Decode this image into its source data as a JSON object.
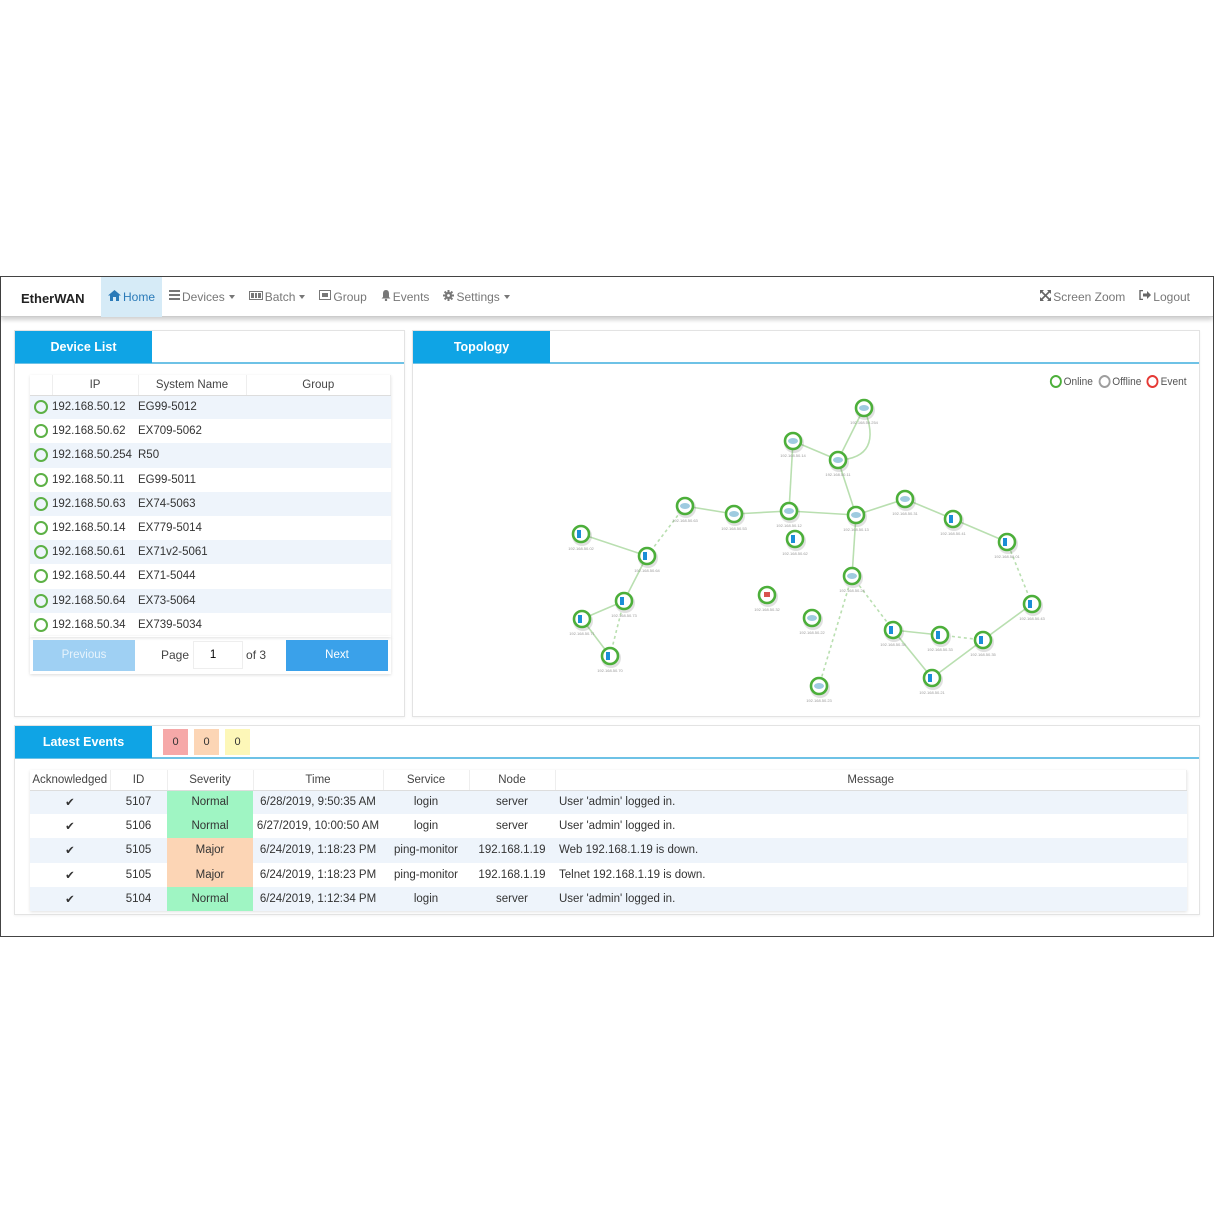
{
  "navbar": {
    "brand": "EtherWAN",
    "items": [
      {
        "label": "Home",
        "icon": "home-icon",
        "active": true
      },
      {
        "label": "Devices",
        "icon": "list-icon",
        "dropdown": true
      },
      {
        "label": "Batch",
        "icon": "batch-icon",
        "dropdown": true
      },
      {
        "label": "Group",
        "icon": "group-icon"
      },
      {
        "label": "Events",
        "icon": "bell-icon"
      },
      {
        "label": "Settings",
        "icon": "gear-icon",
        "dropdown": true
      }
    ],
    "right_items": [
      {
        "label": "Screen Zoom",
        "icon": "expand-icon"
      },
      {
        "label": "Logout",
        "icon": "logout-icon"
      }
    ]
  },
  "device_list": {
    "title": "Device List",
    "columns": [
      "",
      "IP",
      "System Name",
      "Group"
    ],
    "rows": [
      {
        "status": "online",
        "ip": "192.168.50.12",
        "name": "EG99-5012",
        "group": ""
      },
      {
        "status": "online",
        "ip": "192.168.50.62",
        "name": "EX709-5062",
        "group": ""
      },
      {
        "status": "online",
        "ip": "192.168.50.254",
        "name": "R50",
        "group": ""
      },
      {
        "status": "online",
        "ip": "192.168.50.11",
        "name": "EG99-5011",
        "group": ""
      },
      {
        "status": "online",
        "ip": "192.168.50.63",
        "name": "EX74-5063",
        "group": ""
      },
      {
        "status": "online",
        "ip": "192.168.50.14",
        "name": "EX779-5014",
        "group": ""
      },
      {
        "status": "online",
        "ip": "192.168.50.61",
        "name": "EX71v2-5061",
        "group": ""
      },
      {
        "status": "online",
        "ip": "192.168.50.44",
        "name": "EX71-5044",
        "group": ""
      },
      {
        "status": "online",
        "ip": "192.168.50.64",
        "name": "EX73-5064",
        "group": ""
      },
      {
        "status": "online",
        "ip": "192.168.50.34",
        "name": "EX739-5034",
        "group": ""
      }
    ],
    "pager": {
      "previous": "Previous",
      "page_label": "Page",
      "page_value": "1",
      "of_label": "of 3",
      "next": "Next"
    }
  },
  "topology": {
    "title": "Topology",
    "legend": [
      {
        "label": "Online",
        "color": "#4caf3a"
      },
      {
        "label": "Offline",
        "color": "#9e9e9e"
      },
      {
        "label": "Event",
        "color": "#e53935"
      }
    ],
    "nodes": [
      {
        "id": "n254",
        "type": "switch",
        "label": "192.168.50.254"
      },
      {
        "id": "n14",
        "type": "switch",
        "label": "192.168.50.14"
      },
      {
        "id": "n11",
        "type": "switch",
        "label": "192.168.50.11"
      },
      {
        "id": "n63",
        "type": "switch-alert",
        "label": "192.168.50.63"
      },
      {
        "id": "n53",
        "type": "switch",
        "label": "192.168.50.53"
      },
      {
        "id": "n12",
        "type": "switch",
        "label": "192.168.50.12"
      },
      {
        "id": "n13",
        "type": "switch",
        "label": "192.168.50.13"
      },
      {
        "id": "n31",
        "type": "switch",
        "label": "192.168.50.31"
      },
      {
        "id": "n41",
        "type": "device",
        "label": "192.168.50.41"
      },
      {
        "id": "n01",
        "type": "device",
        "label": "192.168.50.01"
      },
      {
        "id": "n02",
        "type": "device",
        "label": "192.168.50.02"
      },
      {
        "id": "n64",
        "type": "device",
        "label": "192.168.50.64"
      },
      {
        "id": "n62",
        "type": "device",
        "label": "192.168.50.62"
      },
      {
        "id": "n24",
        "type": "switch",
        "label": "192.168.50.24"
      },
      {
        "id": "n73",
        "type": "device",
        "label": "192.168.50.73"
      },
      {
        "id": "n71",
        "type": "device",
        "label": "192.168.50.71"
      },
      {
        "id": "n70",
        "type": "device",
        "label": "192.168.50.70"
      },
      {
        "id": "n32",
        "type": "router",
        "label": "192.168.50.32"
      },
      {
        "id": "n22",
        "type": "switch",
        "label": "192.168.50.22"
      },
      {
        "id": "n23",
        "type": "switch",
        "label": "192.168.50.23"
      },
      {
        "id": "n34",
        "type": "device",
        "label": "192.168.50.34"
      },
      {
        "id": "n33",
        "type": "device",
        "label": "192.168.50.33"
      },
      {
        "id": "n35",
        "type": "device",
        "label": "192.168.50.35"
      },
      {
        "id": "n43",
        "type": "device",
        "label": "192.168.50.43"
      },
      {
        "id": "n21",
        "type": "device",
        "label": "192.168.50.21"
      }
    ],
    "links": [
      {
        "from": "n254",
        "to": "n11",
        "style": "solid"
      },
      {
        "from": "n254",
        "to": "n11",
        "style": "curve"
      },
      {
        "from": "n14",
        "to": "n11",
        "style": "solid"
      },
      {
        "from": "n14",
        "to": "n12",
        "style": "solid"
      },
      {
        "from": "n11",
        "to": "n13",
        "style": "solid"
      },
      {
        "from": "n63",
        "to": "n53",
        "style": "solid"
      },
      {
        "from": "n53",
        "to": "n12",
        "style": "solid"
      },
      {
        "from": "n12",
        "to": "n13",
        "style": "solid"
      },
      {
        "from": "n13",
        "to": "n31",
        "style": "solid"
      },
      {
        "from": "n31",
        "to": "n41",
        "style": "solid"
      },
      {
        "from": "n41",
        "to": "n01",
        "style": "solid"
      },
      {
        "from": "n02",
        "to": "n64",
        "style": "solid"
      },
      {
        "from": "n64",
        "to": "n63",
        "style": "dashed"
      },
      {
        "from": "n13",
        "to": "n24",
        "style": "solid"
      },
      {
        "from": "n73",
        "to": "n71",
        "style": "solid"
      },
      {
        "from": "n71",
        "to": "n70",
        "style": "solid"
      },
      {
        "from": "n73",
        "to": "n70",
        "style": "dashed"
      },
      {
        "from": "n73",
        "to": "n64",
        "style": "solid"
      },
      {
        "from": "n24",
        "to": "n23",
        "style": "dashed"
      },
      {
        "from": "n24",
        "to": "n34",
        "style": "dashed"
      },
      {
        "from": "n34",
        "to": "n33",
        "style": "solid"
      },
      {
        "from": "n33",
        "to": "n35",
        "style": "dashed"
      },
      {
        "from": "n34",
        "to": "n21",
        "style": "solid"
      },
      {
        "from": "n21",
        "to": "n35",
        "style": "solid"
      },
      {
        "from": "n35",
        "to": "n43",
        "style": "solid"
      },
      {
        "from": "n43",
        "to": "n01",
        "style": "dashed"
      }
    ]
  },
  "events": {
    "title": "Latest Events",
    "counters": [
      {
        "value": "0",
        "color": "#f6a8a8"
      },
      {
        "value": "0",
        "color": "#fcd5b5"
      },
      {
        "value": "0",
        "color": "#fdf7b8"
      }
    ],
    "columns": [
      "Acknowledged",
      "ID",
      "Severity",
      "Time",
      "Service",
      "Node",
      "Message"
    ],
    "rows": [
      {
        "ack": "✔",
        "id": "5107",
        "severity": "Normal",
        "time": "6/28/2019, 9:50:35 AM",
        "service": "login",
        "node": "server",
        "message": "User 'admin' logged in."
      },
      {
        "ack": "✔",
        "id": "5106",
        "severity": "Normal",
        "time": "6/27/2019, 10:00:50 AM",
        "service": "login",
        "node": "server",
        "message": "User 'admin' logged in."
      },
      {
        "ack": "✔",
        "id": "5105",
        "severity": "Major",
        "time": "6/24/2019, 1:18:23 PM",
        "service": "ping-monitor",
        "node": "192.168.1.19",
        "message": "Web 192.168.1.19 is down."
      },
      {
        "ack": "✔",
        "id": "5105",
        "severity": "Major",
        "time": "6/24/2019, 1:18:23 PM",
        "service": "ping-monitor",
        "node": "192.168.1.19",
        "message": "Telnet 192.168.1.19 is down."
      },
      {
        "ack": "✔",
        "id": "5104",
        "severity": "Normal",
        "time": "6/24/2019, 1:12:34 PM",
        "service": "login",
        "node": "server",
        "message": "User 'admin' logged in."
      }
    ]
  }
}
